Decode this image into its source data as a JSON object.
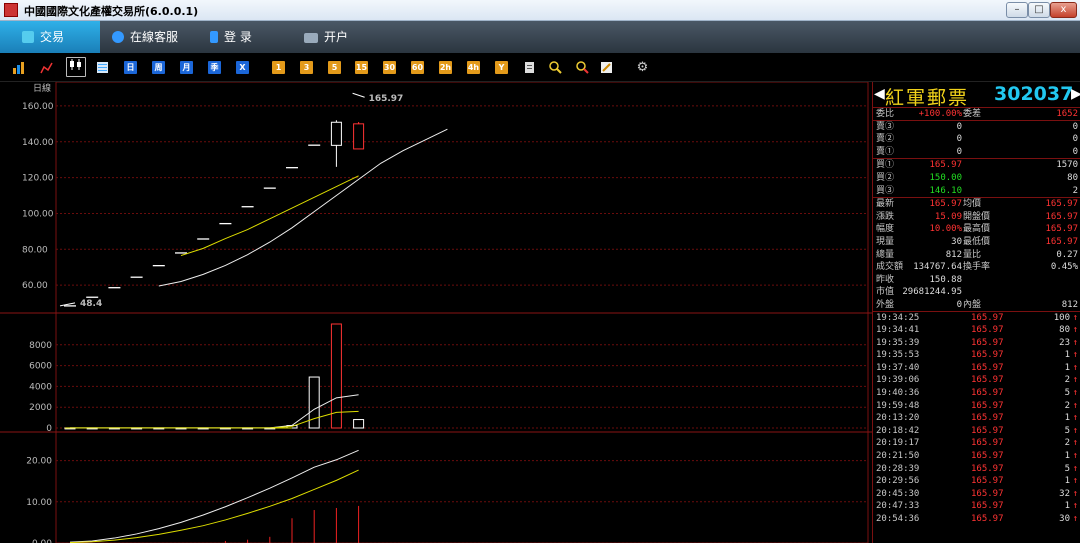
{
  "window": {
    "title": "中國國際文化產權交易所(6.0.0.1)",
    "min": "–",
    "max": "□",
    "close": "x"
  },
  "menu": [
    {
      "label": "交易",
      "color": "#3ad"
    },
    {
      "label": "在線客服",
      "color": "#39f"
    },
    {
      "label": "登  录",
      "color": "#39f"
    },
    {
      "label": "开户",
      "color": "#9ab"
    }
  ],
  "toolbar": {
    "periods": [
      "日",
      "周",
      "月",
      "季",
      "X"
    ],
    "minutes": [
      "1",
      "3",
      "5",
      "15",
      "30",
      "60",
      "2h",
      "4h",
      "Y"
    ],
    "icons": [
      "bar-chart-icon",
      "line-chart-icon",
      "candlestick-icon",
      "list-icon",
      "zoom-in-icon",
      "zoom-out-icon",
      "draw-icon",
      "gear-icon"
    ]
  },
  "chart": {
    "period_label": "日線",
    "annot_high": "165.97",
    "annot_low": "48.4"
  },
  "chart_data": {
    "type": "candlestick",
    "price_axis": {
      "ticks": [
        "160.00",
        "140.00",
        "120.00",
        "100.00",
        "80.00",
        "60.00"
      ],
      "ylim": [
        45,
        170
      ]
    },
    "volume_axis": {
      "ticks": [
        "8000",
        "6000",
        "4000",
        "2000",
        "0"
      ],
      "ylim": [
        0,
        10000
      ]
    },
    "indicator_axis": {
      "ticks": [
        "20.00",
        "10.00",
        "0.00"
      ],
      "ylim": [
        0,
        25
      ]
    },
    "prices": [
      48.4,
      53.24,
      58.56,
      64.42,
      70.86,
      77.95,
      85.74,
      94.32,
      103.75,
      114.12,
      125.54,
      138.09,
      150.88,
      165.97
    ],
    "candle_last_two": [
      {
        "open": 150.88,
        "close": 138,
        "high": 152,
        "low": 126
      },
      {
        "open": 136,
        "close": 150,
        "high": 151,
        "low": 136
      }
    ],
    "ma_short": [
      59.5,
      62,
      66,
      71,
      77,
      84,
      92,
      101,
      110,
      119,
      128,
      135,
      141,
      147
    ],
    "ma_long": [
      76.5,
      80.5,
      86,
      91,
      97,
      103,
      109,
      115,
      121
    ],
    "volumes": [
      10,
      10,
      10,
      10,
      10,
      10,
      10,
      10,
      10,
      10,
      240,
      4900,
      10000,
      812
    ],
    "vol_ma_short": [
      10,
      10,
      10,
      10,
      10,
      10,
      10,
      10,
      10,
      10,
      250,
      1800,
      2900,
      3200
    ],
    "vol_ma_long": [
      10,
      10,
      10,
      10,
      10,
      10,
      10,
      10,
      10,
      10,
      150,
      900,
      1500,
      1600
    ],
    "indicator_white": [
      0.2,
      0.5,
      1.2,
      2.2,
      3.5,
      5.0,
      6.8,
      8.8,
      11.0,
      13.3,
      15.8,
      18.4,
      20.2,
      22.5
    ],
    "indicator_yellow": [
      0.1,
      0.3,
      0.7,
      1.3,
      2.1,
      3.1,
      4.2,
      5.6,
      7.2,
      8.9,
      10.8,
      13.0,
      15.2,
      17.7
    ],
    "indicator_bars": [
      0,
      0,
      0,
      0,
      0,
      0,
      0,
      0.5,
      0.8,
      1.5,
      6,
      8,
      8.5,
      9
    ]
  },
  "quote": {
    "name": "紅軍郵票",
    "code": "302037",
    "weibi_label": "委比",
    "weibi": "+100.00%",
    "weicha_label": "委差",
    "weicha": "1652",
    "sell": [
      {
        "label": "賣③",
        "price": "0",
        "vol": "0"
      },
      {
        "label": "賣②",
        "price": "0",
        "vol": "0"
      },
      {
        "label": "賣①",
        "price": "0",
        "vol": "0"
      }
    ],
    "buy": [
      {
        "label": "買①",
        "price": "165.97",
        "vol": "1570",
        "cls": "red"
      },
      {
        "label": "買②",
        "price": "150.00",
        "vol": "80",
        "cls": "green"
      },
      {
        "label": "買③",
        "price": "146.10",
        "vol": "2",
        "cls": "green"
      }
    ],
    "stats": [
      {
        "l1": "最新",
        "v1": "165.97",
        "c1": "red",
        "l2": "均價",
        "v2": "165.97",
        "c2": "red"
      },
      {
        "l1": "漲跌",
        "v1": "15.09",
        "c1": "red",
        "l2": "開盤價",
        "v2": "165.97",
        "c2": "red"
      },
      {
        "l1": "幅度",
        "v1": "10.00%",
        "c1": "red",
        "l2": "最高價",
        "v2": "165.97",
        "c2": "red"
      },
      {
        "l1": "現量",
        "v1": "30",
        "c1": "white",
        "l2": "最低價",
        "v2": "165.97",
        "c2": "red"
      },
      {
        "l1": "總量",
        "v1": "812",
        "c1": "white",
        "l2": "量比",
        "v2": "0.27",
        "c2": "white"
      },
      {
        "l1": "成交額",
        "v1": "134767.64",
        "c1": "white",
        "l2": "換手率",
        "v2": "0.45%",
        "c2": "white"
      },
      {
        "l1": "昨收",
        "v1": "150.88",
        "c1": "white",
        "l2": "",
        "v2": "",
        "c2": "white"
      },
      {
        "l1": "市值",
        "v1": "29681244.95",
        "c1": "white",
        "l2": "",
        "v2": "",
        "c2": "white"
      }
    ],
    "waipan_label": "外盤",
    "waipan": "0",
    "neipan_label": "內盤",
    "neipan": "812"
  },
  "trades": [
    {
      "time": "19:34:25",
      "price": "165.97",
      "vol": "100"
    },
    {
      "time": "19:34:41",
      "price": "165.97",
      "vol": "80"
    },
    {
      "time": "19:35:39",
      "price": "165.97",
      "vol": "23"
    },
    {
      "time": "19:35:53",
      "price": "165.97",
      "vol": "1"
    },
    {
      "time": "19:37:40",
      "price": "165.97",
      "vol": "1"
    },
    {
      "time": "19:39:06",
      "price": "165.97",
      "vol": "2"
    },
    {
      "time": "19:40:36",
      "price": "165.97",
      "vol": "5"
    },
    {
      "time": "19:59:48",
      "price": "165.97",
      "vol": "2"
    },
    {
      "time": "20:13:20",
      "price": "165.97",
      "vol": "1"
    },
    {
      "time": "20:18:42",
      "price": "165.97",
      "vol": "5"
    },
    {
      "time": "20:19:17",
      "price": "165.97",
      "vol": "2"
    },
    {
      "time": "20:21:50",
      "price": "165.97",
      "vol": "1"
    },
    {
      "time": "20:28:39",
      "price": "165.97",
      "vol": "5"
    },
    {
      "time": "20:29:56",
      "price": "165.97",
      "vol": "1"
    },
    {
      "time": "20:45:30",
      "price": "165.97",
      "vol": "32"
    },
    {
      "time": "20:47:33",
      "price": "165.97",
      "vol": "1"
    },
    {
      "time": "20:54:36",
      "price": "165.97",
      "vol": "30"
    }
  ],
  "trade_arrow": "↑"
}
